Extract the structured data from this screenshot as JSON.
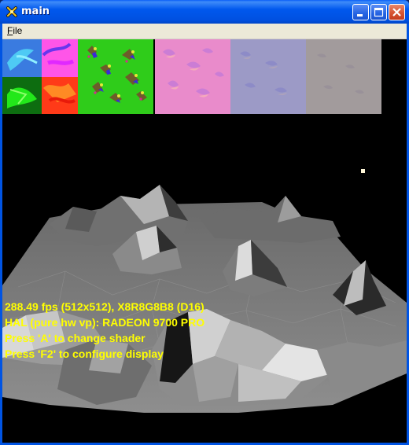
{
  "window": {
    "title": "main",
    "icons": {
      "app": "crossed-tools-icon",
      "minimize": "minimize-icon",
      "maximize": "maximize-icon",
      "close": "close-icon"
    }
  },
  "menu": {
    "file_accel": "F",
    "file_rest": "ile"
  },
  "textures": [
    {
      "name": "normal-map-texture",
      "colors": [
        "#3b7de0",
        "#ff56e6",
        "#0d7d0c",
        "#ff3d1a"
      ]
    },
    {
      "name": "green-terrain-texture",
      "colors": [
        "#34c81c"
      ]
    },
    {
      "name": "pink-bump-texture",
      "colors": [
        "#e88ac8"
      ]
    },
    {
      "name": "lavender-bump-texture",
      "colors": [
        "#9a98c4"
      ]
    },
    {
      "name": "gray-bump-texture",
      "colors": [
        "#a09a9c"
      ]
    }
  ],
  "hud": {
    "line1": "288.49 fps (512x512), X8R8G8B8 (D16)",
    "line2": "HAL (pure hw vp): RADEON 9700 PRO",
    "line3": "Press 'A' to change shader",
    "line4": "Press 'F2' to configure display",
    "color": "#ffff00"
  }
}
